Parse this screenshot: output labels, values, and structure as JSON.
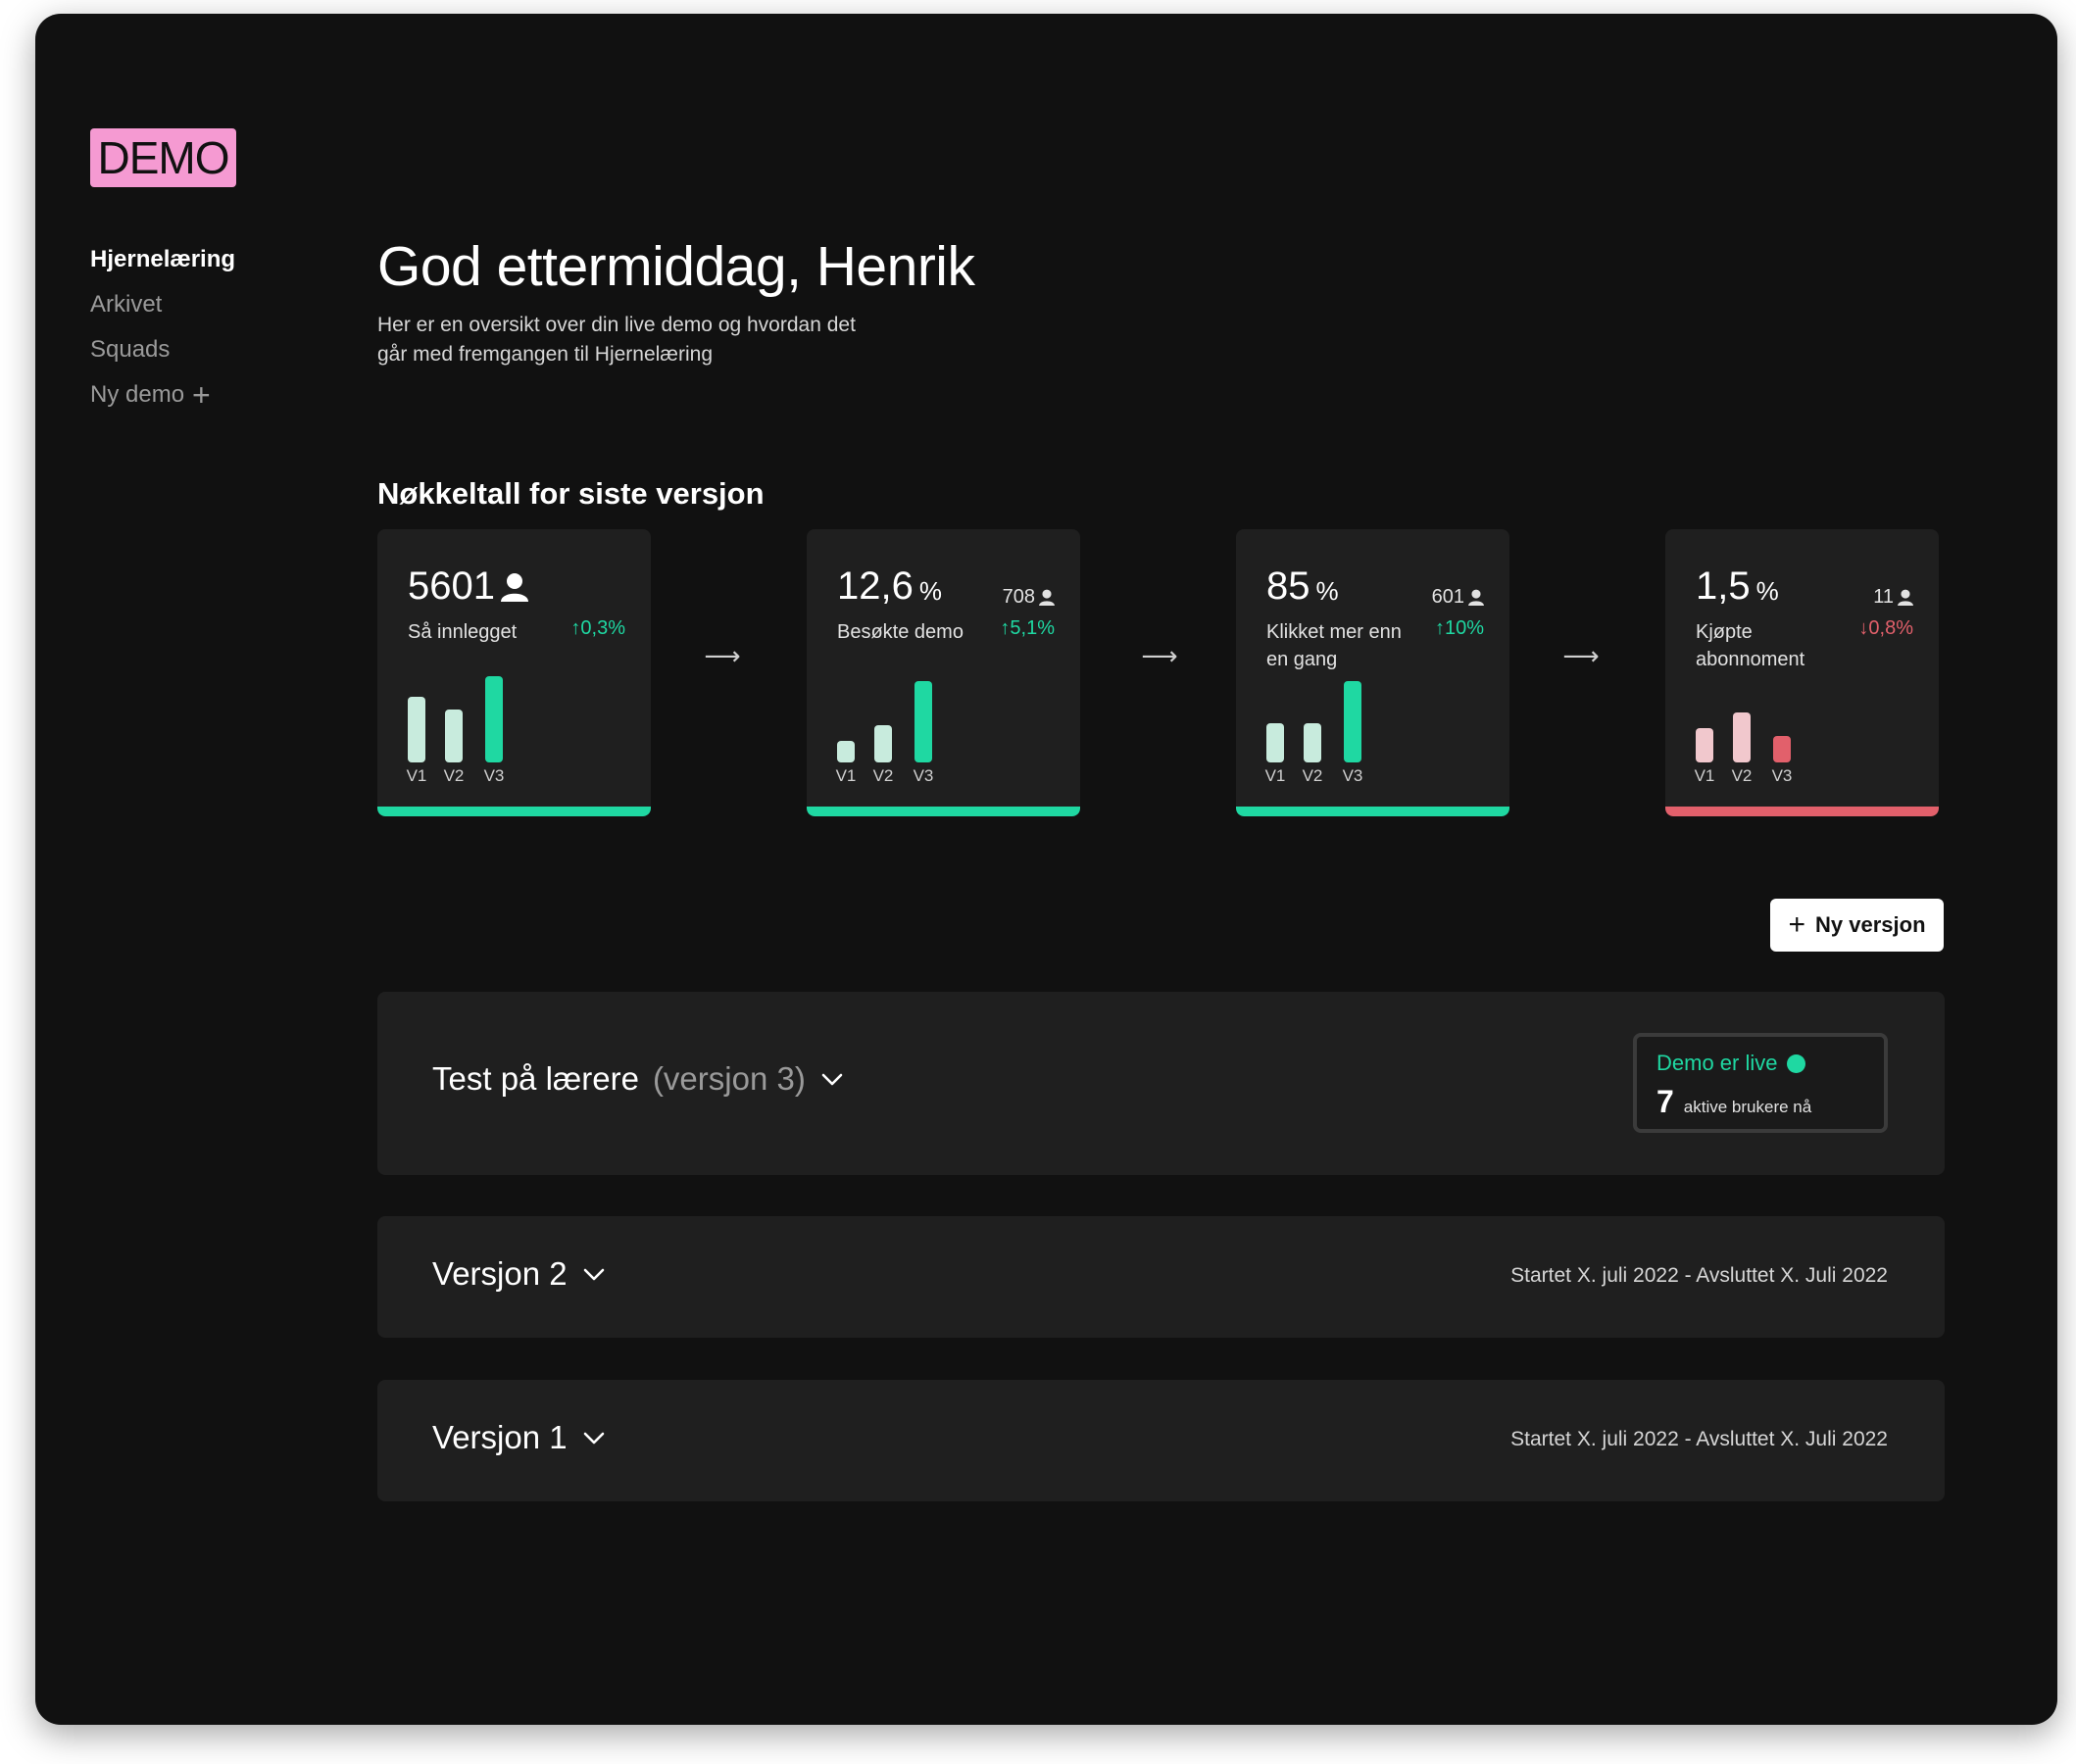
{
  "brand": {
    "logo_text": "DEMO",
    "accent": "#f59ad2"
  },
  "nav": {
    "items": [
      {
        "label": "Hjernelæring",
        "active": true
      },
      {
        "label": "Arkivet",
        "active": false
      },
      {
        "label": "Squads",
        "active": false
      },
      {
        "label": "Ny demo",
        "active": false
      }
    ]
  },
  "header": {
    "greeting": "God ettermiddag, Henrik",
    "subtitle_line1": "Her er en oversikt over din live demo og hvordan det",
    "subtitle_line2": "går med fremgangen til Hjernelæring"
  },
  "metrics": {
    "title": "Nøkkeltall for siste versjon",
    "cards": [
      {
        "value": "5601",
        "unit": "",
        "label": "Så innlegget",
        "count": "",
        "change": "0,3%",
        "trend": "up",
        "bars": [
          0.42,
          0.34,
          0.55
        ],
        "bar_labels": [
          "V1",
          "V2",
          "V3"
        ]
      },
      {
        "value": "12,6",
        "unit": "%",
        "label": "Besøkte demo",
        "count": "708",
        "change": "5,1%",
        "trend": "up",
        "bars": [
          0.14,
          0.24,
          0.52
        ],
        "bar_labels": [
          "V1",
          "V2",
          "V3"
        ]
      },
      {
        "value": "85",
        "unit": "%",
        "label": "Klikket mer enn en gang",
        "count": "601",
        "change": "10%",
        "trend": "up",
        "bars": [
          0.25,
          0.25,
          0.52
        ],
        "bar_labels": [
          "V1",
          "V2",
          "V3"
        ]
      },
      {
        "value": "1,5",
        "unit": "%",
        "label": "Kjøpte abonnoment",
        "count": "11",
        "change": "0,8%",
        "trend": "down",
        "bars": [
          0.22,
          0.32,
          0.17
        ],
        "bar_labels": [
          "V1",
          "V2",
          "V3"
        ]
      }
    ],
    "colors": {
      "up_bar_light": "#c8ebdd",
      "up_bar": "#1fd8a2",
      "down_bar_light": "#f1c8cd",
      "down_bar": "#e2606b"
    }
  },
  "toolbar": {
    "new_version_label": "Ny versjon"
  },
  "versions": [
    {
      "title": "Test på lærere",
      "suffix": "(versjon 3)",
      "live_status": "Demo er live",
      "active_users": "7",
      "active_users_label": "aktive brukere nå"
    },
    {
      "title": "Versjon 2",
      "dates": "Startet X. juli 2022 - Avsluttet X. Juli 2022"
    },
    {
      "title": "Versjon 1",
      "dates": "Startet X. juli 2022 - Avsluttet X. Juli 2022"
    }
  ]
}
